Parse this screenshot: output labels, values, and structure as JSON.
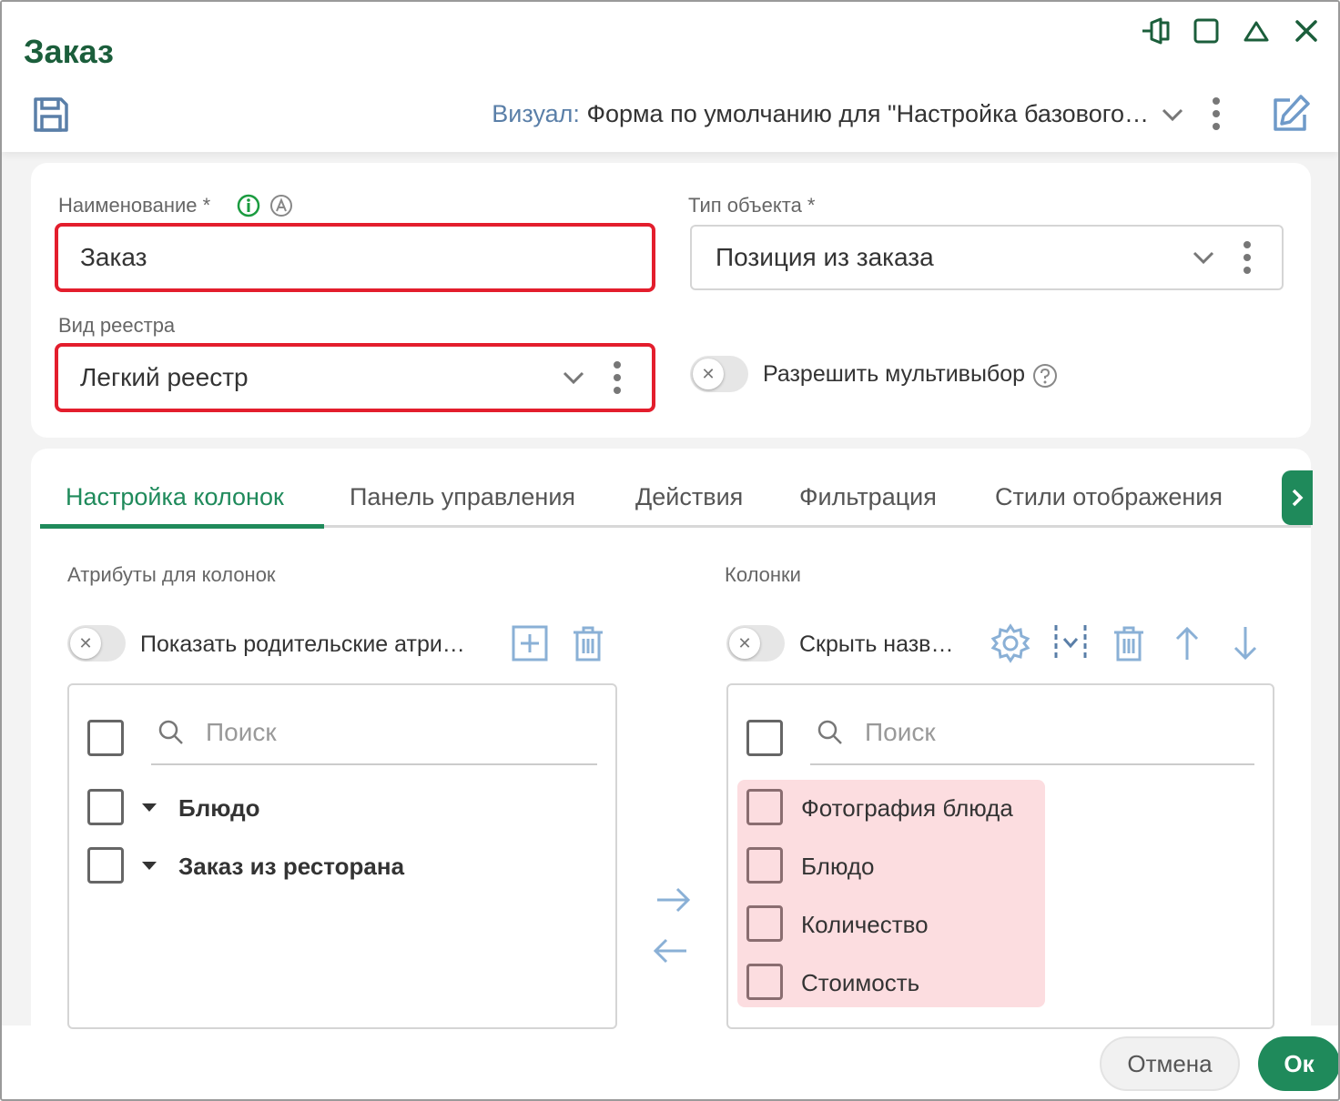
{
  "window": {
    "title": "Заказ"
  },
  "toolbar": {
    "visual_label": "Визуал:",
    "visual_value": "Форма по умолчанию для \"Настройка базового…"
  },
  "form": {
    "name_label": "Наименование *",
    "name_value": "Заказ",
    "object_type_label": "Тип объекта *",
    "object_type_value": "Позиция из заказа",
    "registry_label": "Вид реестра",
    "registry_value": "Легкий реестр",
    "multiselect_label": "Разрешить мультивыбор"
  },
  "tabs": [
    {
      "label": "Настройка колонок",
      "active": true
    },
    {
      "label": "Панель управления",
      "active": false
    },
    {
      "label": "Действия",
      "active": false
    },
    {
      "label": "Фильтрация",
      "active": false
    },
    {
      "label": "Стили отображения",
      "active": false
    }
  ],
  "attributes": {
    "section_label": "Атрибуты для колонок",
    "toggle_label": "Показать родительские атри…",
    "search_placeholder": "Поиск",
    "items": [
      "Блюдо",
      "Заказ из ресторана"
    ]
  },
  "columns": {
    "section_label": "Колонки",
    "toggle_label": "Скрыть назв…",
    "search_placeholder": "Поиск",
    "items": [
      "Фотография блюда",
      "Блюдо",
      "Количество",
      "Стоимость"
    ]
  },
  "footer": {
    "cancel_label": "Отмена",
    "ok_label": "Ок"
  },
  "colors": {
    "accent": "#1f8a5b",
    "title": "#1b5e3b",
    "error_border": "#e31e2d",
    "highlight": "#fcdde0"
  }
}
